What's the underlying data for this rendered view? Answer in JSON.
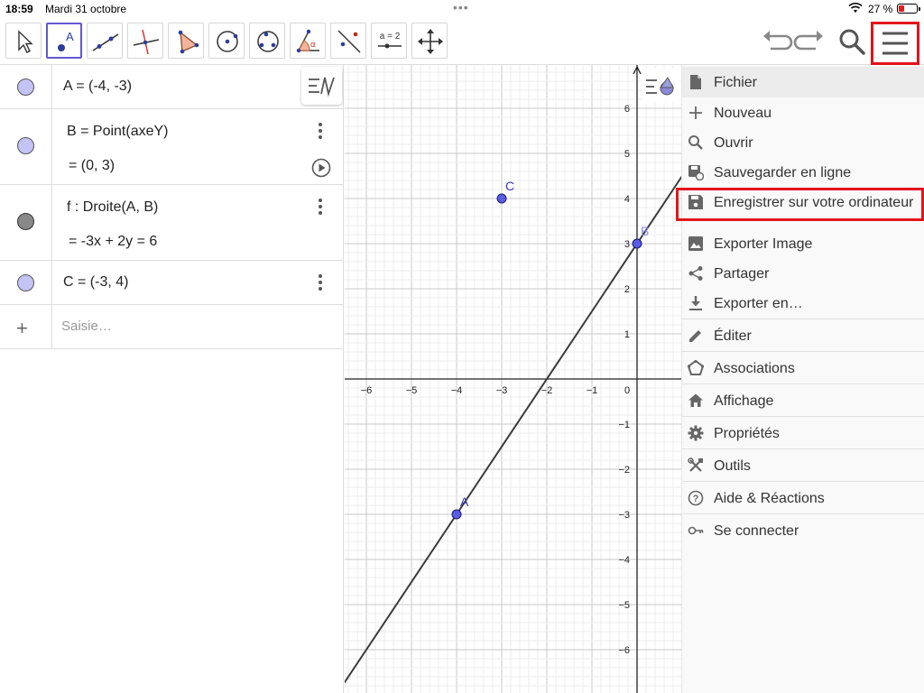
{
  "status_bar": {
    "time": "18:59",
    "date": "Mardi 31 octobre",
    "battery": "27 %",
    "battery_color": "#e02020"
  },
  "toolbar": {
    "tools": [
      "move-tool-icon",
      "point-tool-icon",
      "line-tool-icon",
      "perpendicular-tool-icon",
      "polygon-tool-icon",
      "circle-tool-icon",
      "conic-tool-icon",
      "angle-tool-icon",
      "reflect-tool-icon",
      "slider-tool-icon",
      "move-view-tool-icon"
    ],
    "active_tool": "point-tool-icon",
    "point_tool_label": "A",
    "slider_tool_label": "a = 2",
    "accent": "#6557d2"
  },
  "algebra": {
    "rows": [
      {
        "text": "A = (-4, -3)"
      },
      {
        "text": "B = Point(axeY)",
        "value": "= (0, 3)"
      },
      {
        "text": "f : Droite(A, B)",
        "value": "= -3x + 2y = 6"
      },
      {
        "text": "C = (-3, 4)"
      }
    ],
    "input_placeholder": "Saisie…",
    "point_color": "#c3c3f5",
    "line_color": "#888888"
  },
  "graphics": {
    "x_ticks": [
      "−6",
      "−5",
      "−4",
      "−3",
      "−2",
      "−1",
      "0"
    ],
    "y_ticks": [
      "6",
      "5",
      "4",
      "3",
      "2",
      "1",
      "−1",
      "−2",
      "−3",
      "−4",
      "−5",
      "−6"
    ],
    "points": [
      {
        "name": "A",
        "x": -4,
        "y": -3
      },
      {
        "name": "B",
        "x": 0,
        "y": 3
      },
      {
        "name": "C",
        "x": -3,
        "y": 4
      }
    ],
    "line": {
      "name": "f",
      "equation": "-3x + 2y = 6"
    }
  },
  "menu": {
    "items": [
      {
        "label": "Fichier",
        "icon": "file-icon"
      },
      {
        "label": "Nouveau",
        "icon": "plus-icon"
      },
      {
        "label": "Ouvrir",
        "icon": "search-icon"
      },
      {
        "label": "Sauvegarder en ligne",
        "icon": "cloud-save-icon"
      },
      {
        "label": "Enregistrer sur votre ordinateur",
        "icon": "save-icon"
      },
      {
        "label": "Exporter Image",
        "icon": "image-icon"
      },
      {
        "label": "Partager",
        "icon": "share-icon"
      },
      {
        "label": "Exporter en…",
        "icon": "download-icon"
      },
      {
        "label": "Éditer",
        "icon": "pencil-icon"
      },
      {
        "label": "Associations",
        "icon": "perspectives-icon"
      },
      {
        "label": "Affichage",
        "icon": "home-icon"
      },
      {
        "label": "Propriétés",
        "icon": "gear-icon"
      },
      {
        "label": "Outils",
        "icon": "tools-icon"
      },
      {
        "label": "Aide & Réactions",
        "icon": "help-icon"
      },
      {
        "label": "Se connecter",
        "icon": "sign-in-icon"
      }
    ],
    "highlight_color": "#e3141b"
  }
}
